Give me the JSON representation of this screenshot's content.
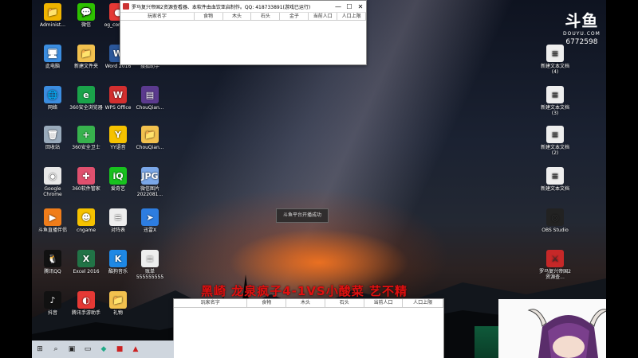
{
  "desktop_icons": [
    {
      "label": "Administ...",
      "color": "#f0b400",
      "glyph": "📁"
    },
    {
      "label": "微信",
      "color": "#2dc100",
      "glyph": "💬"
    },
    {
      "label": "og_correc...",
      "color": "#e53935",
      "glyph": "●"
    },
    {
      "label": "此电脑",
      "color": "#3b8de0",
      "glyph": "🖥"
    },
    {
      "label": "新建文件夹",
      "color": "#f2c14e",
      "glyph": "📁"
    },
    {
      "label": "Word 2016",
      "color": "#2b579a",
      "glyph": "W"
    },
    {
      "label": "搜狐助手",
      "color": "#444",
      "glyph": "✦"
    },
    {
      "label": "网络",
      "color": "#3b8de0",
      "glyph": "🌐"
    },
    {
      "label": "360安全浏览器",
      "color": "#1aa34a",
      "glyph": "e"
    },
    {
      "label": "WPS Office",
      "color": "#d32f2f",
      "glyph": "W"
    },
    {
      "label": "ChouQian...",
      "color": "#5b3a8e",
      "glyph": "▤"
    },
    {
      "label": "回收站",
      "color": "#9ab",
      "glyph": "🗑"
    },
    {
      "label": "360安全卫士",
      "color": "#37b24d",
      "glyph": "+"
    },
    {
      "label": "YY语音",
      "color": "#f6c200",
      "glyph": "Y"
    },
    {
      "label": "ChouQian...",
      "color": "#f2c14e",
      "glyph": "📁"
    },
    {
      "label": "Google Chrome",
      "color": "#e8e8e8",
      "glyph": "◉"
    },
    {
      "label": "360软件管家",
      "color": "#e0506e",
      "glyph": "✚"
    },
    {
      "label": "爱奇艺",
      "color": "#18c21e",
      "glyph": "iQ"
    },
    {
      "label": "微信图片 2022081...",
      "color": "#7aa7e8",
      "glyph": "JPG"
    },
    {
      "label": "斗鱼直播伴侣",
      "color": "#f07d1a",
      "glyph": "▶"
    },
    {
      "label": "cngame",
      "color": "#f6c200",
      "glyph": "☻"
    },
    {
      "label": "对阵表",
      "color": "#eee",
      "glyph": "≡"
    },
    {
      "label": "迅雷X",
      "color": "#2d7de0",
      "glyph": "➤"
    },
    {
      "label": "腾讯QQ",
      "color": "#111",
      "glyph": "🐧"
    },
    {
      "label": "Excel 2016",
      "color": "#217346",
      "glyph": "X"
    },
    {
      "label": "酷狗音乐",
      "color": "#1e88e5",
      "glyph": "K"
    },
    {
      "label": "账单 555555555",
      "color": "#eee",
      "glyph": "≡"
    },
    {
      "label": "抖音",
      "color": "#111",
      "glyph": "♪"
    },
    {
      "label": "腾讯手游助手",
      "color": "#e53935",
      "glyph": "◐"
    },
    {
      "label": "礼物",
      "color": "#f2c14e",
      "glyph": "📁"
    }
  ],
  "right_icons": [
    {
      "label": "新建文本文档 (4)",
      "color": "#eee",
      "glyph": "≡"
    },
    {
      "label": "新建文本文档 (3)",
      "color": "#eee",
      "glyph": "≡"
    },
    {
      "label": "新建文本文档 (2)",
      "color": "#eee",
      "glyph": "≡"
    },
    {
      "label": "新建文本文档",
      "color": "#eee",
      "glyph": "≡"
    },
    {
      "label": "OBS Studio",
      "color": "#222",
      "glyph": "◎"
    },
    {
      "label": "罗马复兴帝国2资源查...",
      "color": "#c62828",
      "glyph": "⚔"
    }
  ],
  "top_window": {
    "title": "罗马复兴帝国2资源查看器、本软件由血饮亚启制作。QQ: 418733891(游戏已运行)",
    "columns": [
      "玩家名字",
      "食物",
      "木头",
      "石头",
      "金子",
      "当前人口",
      "人口上限"
    ]
  },
  "bottom_window": {
    "columns": [
      "玩家名字",
      "食物",
      "木头",
      "石头",
      "当前人口",
      "人口上限"
    ]
  },
  "toast": "斗鱼平台开播成功",
  "caption": "黑崎 龙泉疯子4-1VS小酸菜 艺不精",
  "douyu": {
    "logo": "斗鱼",
    "sub": "DOUYU.COM",
    "room": "6772598"
  },
  "window_controls": {
    "minimize": "—",
    "maximize": "☐",
    "close": "✕"
  },
  "taskbar": [
    "start-icon",
    "search-icon",
    "explorer-icon",
    "folder-icon",
    "chat-icon",
    "app-icon",
    "game-icon"
  ]
}
